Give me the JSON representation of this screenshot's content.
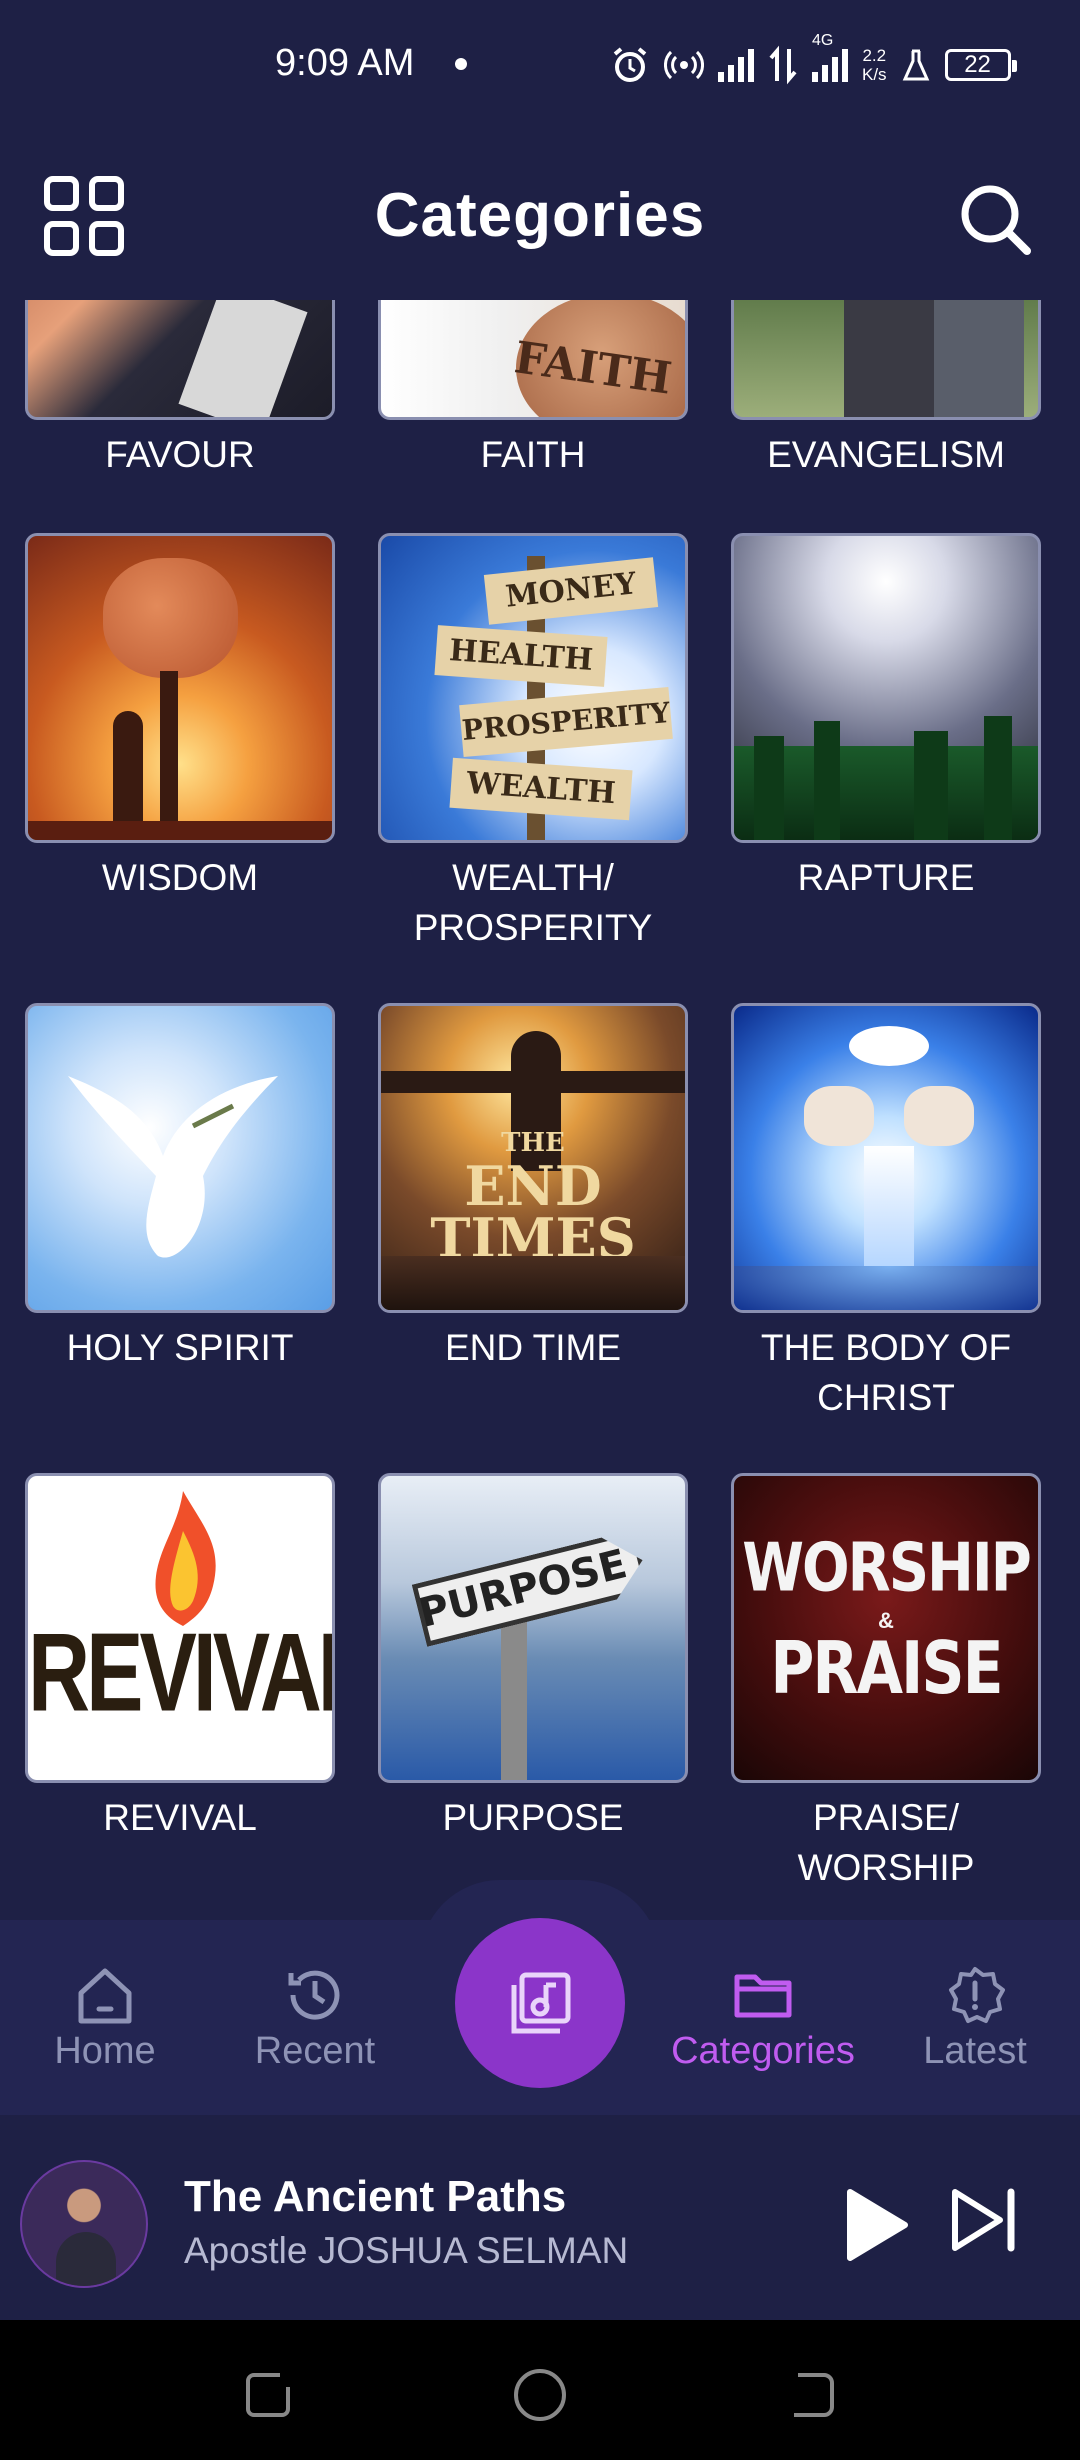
{
  "status_bar": {
    "time": "9:09 AM",
    "network_type": "4G",
    "speed_value": "2.2",
    "speed_unit": "K/s",
    "battery": "22"
  },
  "header": {
    "title": "Categories",
    "menu_icon": "grid-icon",
    "search_icon": "search-icon"
  },
  "categories": [
    {
      "label": "FAVOUR"
    },
    {
      "label": "FAITH",
      "image_text": "FAITH"
    },
    {
      "label": "EVANGELISM"
    },
    {
      "label": "WISDOM"
    },
    {
      "label": "WEALTH/ PROSPERITY",
      "signs": [
        "MONEY",
        "HEALTH",
        "PROSPERITY",
        "WEALTH"
      ]
    },
    {
      "label": "RAPTURE"
    },
    {
      "label": "HOLY SPIRIT"
    },
    {
      "label": "END TIME",
      "image_text": [
        "THE",
        "END",
        "TIMES"
      ]
    },
    {
      "label": "THE BODY OF CHRIST"
    },
    {
      "label": "REVIVAL",
      "image_text": "REVIVAL"
    },
    {
      "label": "PURPOSE",
      "image_text": "PURPOSE"
    },
    {
      "label": "PRAISE/ WORSHIP",
      "image_text": [
        "WORSHIP",
        "&",
        "PRAISE"
      ]
    }
  ],
  "bottom_nav": {
    "items": [
      {
        "label": "Home",
        "icon": "home-icon"
      },
      {
        "label": "Recent",
        "icon": "history-icon"
      },
      {
        "label": "Categories",
        "icon": "folder-icon",
        "active": true
      },
      {
        "label": "Latest",
        "icon": "alert-badge-icon"
      }
    ],
    "center_icon": "music-library-icon"
  },
  "now_playing": {
    "title": "The Ancient Paths",
    "artist": "Apostle JOSHUA SELMAN"
  },
  "colors": {
    "background": "#1e2045",
    "nav_background": "#232552",
    "accent": "#8b35c9",
    "active_nav": "#c05cf0",
    "inactive_nav": "#8e93b5"
  }
}
